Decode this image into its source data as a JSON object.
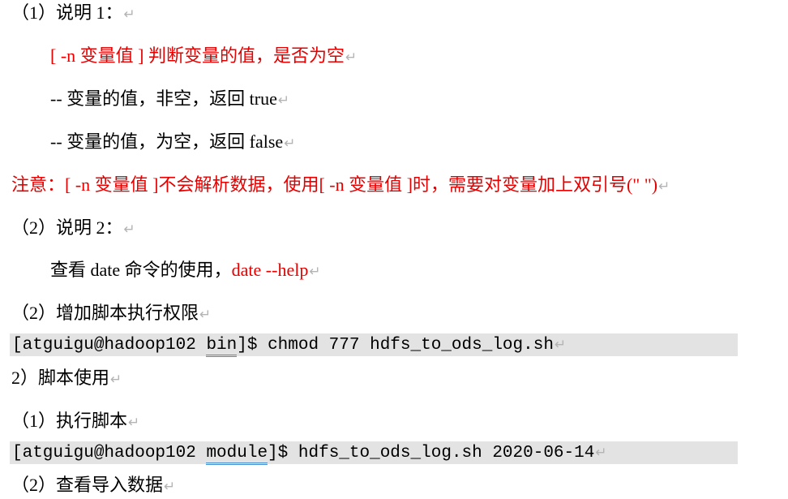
{
  "lines": {
    "l1": "（1）说明 1：",
    "l2": "[ -n  变量值  ]  判断变量的值，是否为空",
    "l3": "--  变量的值，非空，返回 true",
    "l4": "--  变量的值，为空，返回 false",
    "l5": "注意：[ -n  变量值  ]不会解析数据，使用[ -n  变量值  ]时，需要对变量加上双引号(\" \")",
    "l6": "（2）说明 2：",
    "l7a": "查看 date 命令的使用，",
    "l7b": "date --help",
    "l8": "（2）增加脚本执行权限",
    "l10": "2）脚本使用",
    "l11": "（1）执行脚本",
    "l13": "（2）查看导入数据"
  },
  "code1": {
    "prefix": "[atguigu@hadoop102 ",
    "dir": "bin",
    "suffix": "]$ chmod 777 hdfs_to_ods_log.sh"
  },
  "code2": {
    "prefix": "[atguigu@hadoop102 ",
    "dir": "module",
    "suffix": "]$ hdfs_to_ods_log.sh 2020-06-14"
  },
  "paragraph_mark": "↵"
}
